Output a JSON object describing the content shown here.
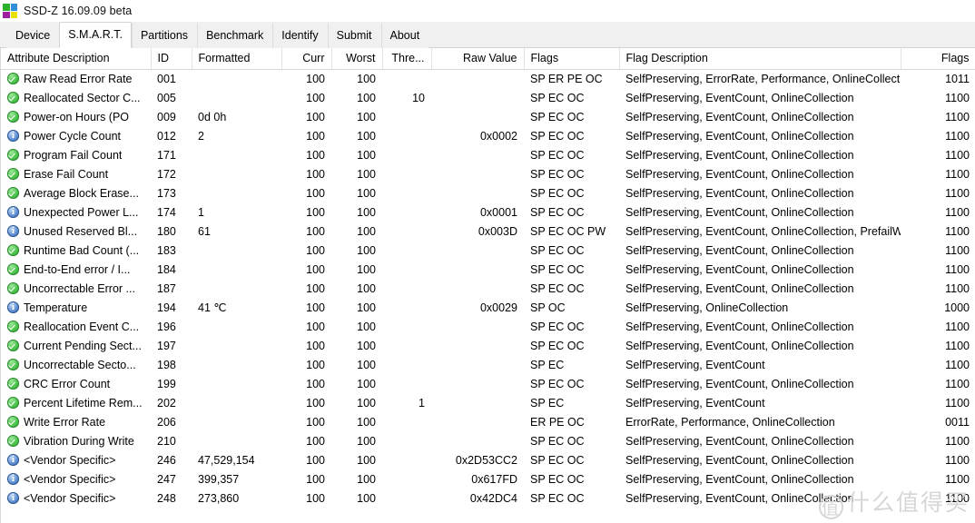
{
  "window": {
    "title": "SSD-Z 16.09.09 beta",
    "icon": "ssdz-logo-icon"
  },
  "tabs": [
    {
      "label": "Device",
      "active": false
    },
    {
      "label": "S.M.A.R.T.",
      "active": true
    },
    {
      "label": "Partitions",
      "active": false
    },
    {
      "label": "Benchmark",
      "active": false
    },
    {
      "label": "Identify",
      "active": false
    },
    {
      "label": "Submit",
      "active": false
    },
    {
      "label": "About",
      "active": false
    }
  ],
  "table": {
    "columns": [
      {
        "label": "Attribute Description",
        "align": "left"
      },
      {
        "label": "ID",
        "align": "left"
      },
      {
        "label": "Formatted",
        "align": "left"
      },
      {
        "label": "Curr",
        "align": "right"
      },
      {
        "label": "Worst",
        "align": "right"
      },
      {
        "label": "Thre...",
        "align": "right"
      },
      {
        "label": "Raw Value",
        "align": "right"
      },
      {
        "label": "Flags",
        "align": "left"
      },
      {
        "label": "Flag Description",
        "align": "left"
      },
      {
        "label": "Flags",
        "align": "right"
      }
    ],
    "rows": [
      {
        "icon": "ok",
        "attribute": "Raw Read Error Rate",
        "id": "001",
        "formatted": "",
        "curr": "100",
        "worst": "100",
        "threshold": "",
        "raw": "",
        "flags": "SP ER PE OC",
        "flag_description": "SelfPreserving, ErrorRate, Performance, OnlineCollection, Pref...",
        "flag_bits": "1011"
      },
      {
        "icon": "ok",
        "attribute": "Reallocated Sector C...",
        "id": "005",
        "formatted": "",
        "curr": "100",
        "worst": "100",
        "threshold": "10",
        "raw": "",
        "flags": "SP EC OC",
        "flag_description": "SelfPreserving, EventCount, OnlineCollection",
        "flag_bits": "1100"
      },
      {
        "icon": "ok",
        "attribute": "Power-on Hours (PO",
        "id": "009",
        "formatted": "0d 0h",
        "curr": "100",
        "worst": "100",
        "threshold": "",
        "raw": "",
        "flags": "SP EC OC",
        "flag_description": "SelfPreserving, EventCount, OnlineCollection",
        "flag_bits": "1100"
      },
      {
        "icon": "info",
        "attribute": "Power Cycle Count",
        "id": "012",
        "formatted": "2",
        "curr": "100",
        "worst": "100",
        "threshold": "",
        "raw": "0x0002",
        "flags": "SP EC OC",
        "flag_description": "SelfPreserving, EventCount, OnlineCollection",
        "flag_bits": "1100"
      },
      {
        "icon": "ok",
        "attribute": "Program Fail Count",
        "id": "171",
        "formatted": "",
        "curr": "100",
        "worst": "100",
        "threshold": "",
        "raw": "",
        "flags": "SP EC OC",
        "flag_description": "SelfPreserving, EventCount, OnlineCollection",
        "flag_bits": "1100"
      },
      {
        "icon": "ok",
        "attribute": "Erase Fail Count",
        "id": "172",
        "formatted": "",
        "curr": "100",
        "worst": "100",
        "threshold": "",
        "raw": "",
        "flags": "SP EC OC",
        "flag_description": "SelfPreserving, EventCount, OnlineCollection",
        "flag_bits": "1100"
      },
      {
        "icon": "ok",
        "attribute": "Average Block Erase...",
        "id": "173",
        "formatted": "",
        "curr": "100",
        "worst": "100",
        "threshold": "",
        "raw": "",
        "flags": "SP EC OC",
        "flag_description": "SelfPreserving, EventCount, OnlineCollection",
        "flag_bits": "1100"
      },
      {
        "icon": "info",
        "attribute": "Unexpected Power L...",
        "id": "174",
        "formatted": "1",
        "curr": "100",
        "worst": "100",
        "threshold": "",
        "raw": "0x0001",
        "flags": "SP EC OC",
        "flag_description": "SelfPreserving, EventCount, OnlineCollection",
        "flag_bits": "1100"
      },
      {
        "icon": "info",
        "attribute": "Unused Reserved Bl...",
        "id": "180",
        "formatted": "61",
        "curr": "100",
        "worst": "100",
        "threshold": "",
        "raw": "0x003D",
        "flags": "SP EC OC PW",
        "flag_description": "SelfPreserving, EventCount, OnlineCollection, PrefailWarranty",
        "flag_bits": "1100"
      },
      {
        "icon": "ok",
        "attribute": "Runtime Bad Count (...",
        "id": "183",
        "formatted": "",
        "curr": "100",
        "worst": "100",
        "threshold": "",
        "raw": "",
        "flags": "SP EC OC",
        "flag_description": "SelfPreserving, EventCount, OnlineCollection",
        "flag_bits": "1100"
      },
      {
        "icon": "ok",
        "attribute": "End-to-End error / I...",
        "id": "184",
        "formatted": "",
        "curr": "100",
        "worst": "100",
        "threshold": "",
        "raw": "",
        "flags": "SP EC OC",
        "flag_description": "SelfPreserving, EventCount, OnlineCollection",
        "flag_bits": "1100"
      },
      {
        "icon": "ok",
        "attribute": "Uncorrectable Error ...",
        "id": "187",
        "formatted": "",
        "curr": "100",
        "worst": "100",
        "threshold": "",
        "raw": "",
        "flags": "SP EC OC",
        "flag_description": "SelfPreserving, EventCount, OnlineCollection",
        "flag_bits": "1100"
      },
      {
        "icon": "info",
        "attribute": "Temperature",
        "id": "194",
        "formatted": "41 ℃",
        "curr": "100",
        "worst": "100",
        "threshold": "",
        "raw": "0x0029",
        "flags": "SP OC",
        "flag_description": "SelfPreserving, OnlineCollection",
        "flag_bits": "1000"
      },
      {
        "icon": "ok",
        "attribute": "Reallocation Event C...",
        "id": "196",
        "formatted": "",
        "curr": "100",
        "worst": "100",
        "threshold": "",
        "raw": "",
        "flags": "SP EC OC",
        "flag_description": "SelfPreserving, EventCount, OnlineCollection",
        "flag_bits": "1100"
      },
      {
        "icon": "ok",
        "attribute": "Current Pending Sect...",
        "id": "197",
        "formatted": "",
        "curr": "100",
        "worst": "100",
        "threshold": "",
        "raw": "",
        "flags": "SP EC OC",
        "flag_description": "SelfPreserving, EventCount, OnlineCollection",
        "flag_bits": "1100"
      },
      {
        "icon": "ok",
        "attribute": "Uncorrectable Secto...",
        "id": "198",
        "formatted": "",
        "curr": "100",
        "worst": "100",
        "threshold": "",
        "raw": "",
        "flags": "SP EC",
        "flag_description": "SelfPreserving, EventCount",
        "flag_bits": "1100"
      },
      {
        "icon": "ok",
        "attribute": "CRC Error Count",
        "id": "199",
        "formatted": "",
        "curr": "100",
        "worst": "100",
        "threshold": "",
        "raw": "",
        "flags": "SP EC OC",
        "flag_description": "SelfPreserving, EventCount, OnlineCollection",
        "flag_bits": "1100"
      },
      {
        "icon": "ok",
        "attribute": "Percent Lifetime Rem...",
        "id": "202",
        "formatted": "",
        "curr": "100",
        "worst": "100",
        "threshold": "1",
        "raw": "",
        "flags": "SP EC",
        "flag_description": "SelfPreserving, EventCount",
        "flag_bits": "1100"
      },
      {
        "icon": "ok",
        "attribute": "Write Error Rate",
        "id": "206",
        "formatted": "",
        "curr": "100",
        "worst": "100",
        "threshold": "",
        "raw": "",
        "flags": "ER PE OC",
        "flag_description": "ErrorRate, Performance, OnlineCollection",
        "flag_bits": "0011"
      },
      {
        "icon": "ok",
        "attribute": "Vibration During Write",
        "id": "210",
        "formatted": "",
        "curr": "100",
        "worst": "100",
        "threshold": "",
        "raw": "",
        "flags": "SP EC OC",
        "flag_description": "SelfPreserving, EventCount, OnlineCollection",
        "flag_bits": "1100"
      },
      {
        "icon": "info",
        "attribute": "<Vendor Specific>",
        "id": "246",
        "formatted": "47,529,154",
        "curr": "100",
        "worst": "100",
        "threshold": "",
        "raw": "0x2D53CC2",
        "flags": "SP EC OC",
        "flag_description": "SelfPreserving, EventCount, OnlineCollection",
        "flag_bits": "1100"
      },
      {
        "icon": "info",
        "attribute": "<Vendor Specific>",
        "id": "247",
        "formatted": "399,357",
        "curr": "100",
        "worst": "100",
        "threshold": "",
        "raw": "0x617FD",
        "flags": "SP EC OC",
        "flag_description": "SelfPreserving, EventCount, OnlineCollection",
        "flag_bits": "1100"
      },
      {
        "icon": "info",
        "attribute": "<Vendor Specific>",
        "id": "248",
        "formatted": "273,860",
        "curr": "100",
        "worst": "100",
        "threshold": "",
        "raw": "0x42DC4",
        "flags": "SP EC OC",
        "flag_description": "SelfPreserving, EventCount, OnlineCollection",
        "flag_bits": "1100"
      }
    ]
  },
  "watermark": {
    "badge": "值",
    "text": "什么值得买"
  }
}
